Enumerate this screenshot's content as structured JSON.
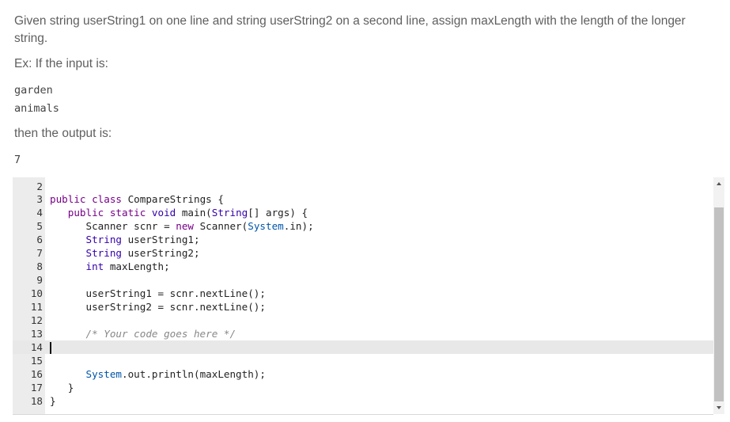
{
  "prompt": {
    "text": "Given string userString1 on one line and string userString2 on a second line, assign maxLength with the length of the longer string.",
    "example_label": "Ex: If the input is:",
    "input_lines": [
      "garden",
      "animals"
    ],
    "then_label": "then the output is:",
    "output": "7"
  },
  "editor": {
    "lines": [
      {
        "n": "2"
      },
      {
        "n": "3"
      },
      {
        "n": "4"
      },
      {
        "n": "5"
      },
      {
        "n": "6"
      },
      {
        "n": "7"
      },
      {
        "n": "8"
      },
      {
        "n": "9"
      },
      {
        "n": "10"
      },
      {
        "n": "11"
      },
      {
        "n": "12"
      },
      {
        "n": "13"
      },
      {
        "n": "14"
      },
      {
        "n": "15"
      },
      {
        "n": "16"
      },
      {
        "n": "17"
      },
      {
        "n": "18"
      }
    ],
    "code": {
      "l3_public": "public",
      "l3_class": "class",
      "l3_name": " CompareStrings {",
      "l4_ind": "   ",
      "l4_public": "public",
      "l4_static": " static",
      "l4_void": " void",
      "l4_rest": " main(",
      "l4_String": "String",
      "l4_end": "[] args) {",
      "l5_ind": "      ",
      "l5_a": "Scanner scnr = ",
      "l5_new": "new",
      "l5_b": " Scanner(",
      "l5_sys": "System",
      "l5_c": ".in);",
      "l6_ind": "      ",
      "l6_type": "String",
      "l6_rest": " userString1;",
      "l7_ind": "      ",
      "l7_type": "String",
      "l7_rest": " userString2;",
      "l8_ind": "      ",
      "l8_type": "int",
      "l8_rest": " maxLength;",
      "l10": "      userString1 = scnr.nextLine();",
      "l11": "      userString2 = scnr.nextLine();",
      "l13_ind": "      ",
      "l13_cmt": "/* Your code goes here */",
      "l16_ind": "      ",
      "l16_sys": "System",
      "l16_rest": ".out.println(maxLength);",
      "l17": "   }",
      "l18": "}"
    }
  },
  "colors": {
    "keyword": "#770088",
    "type": "#3300aa",
    "string_builtin": "#0055aa",
    "comment": "#888888"
  }
}
